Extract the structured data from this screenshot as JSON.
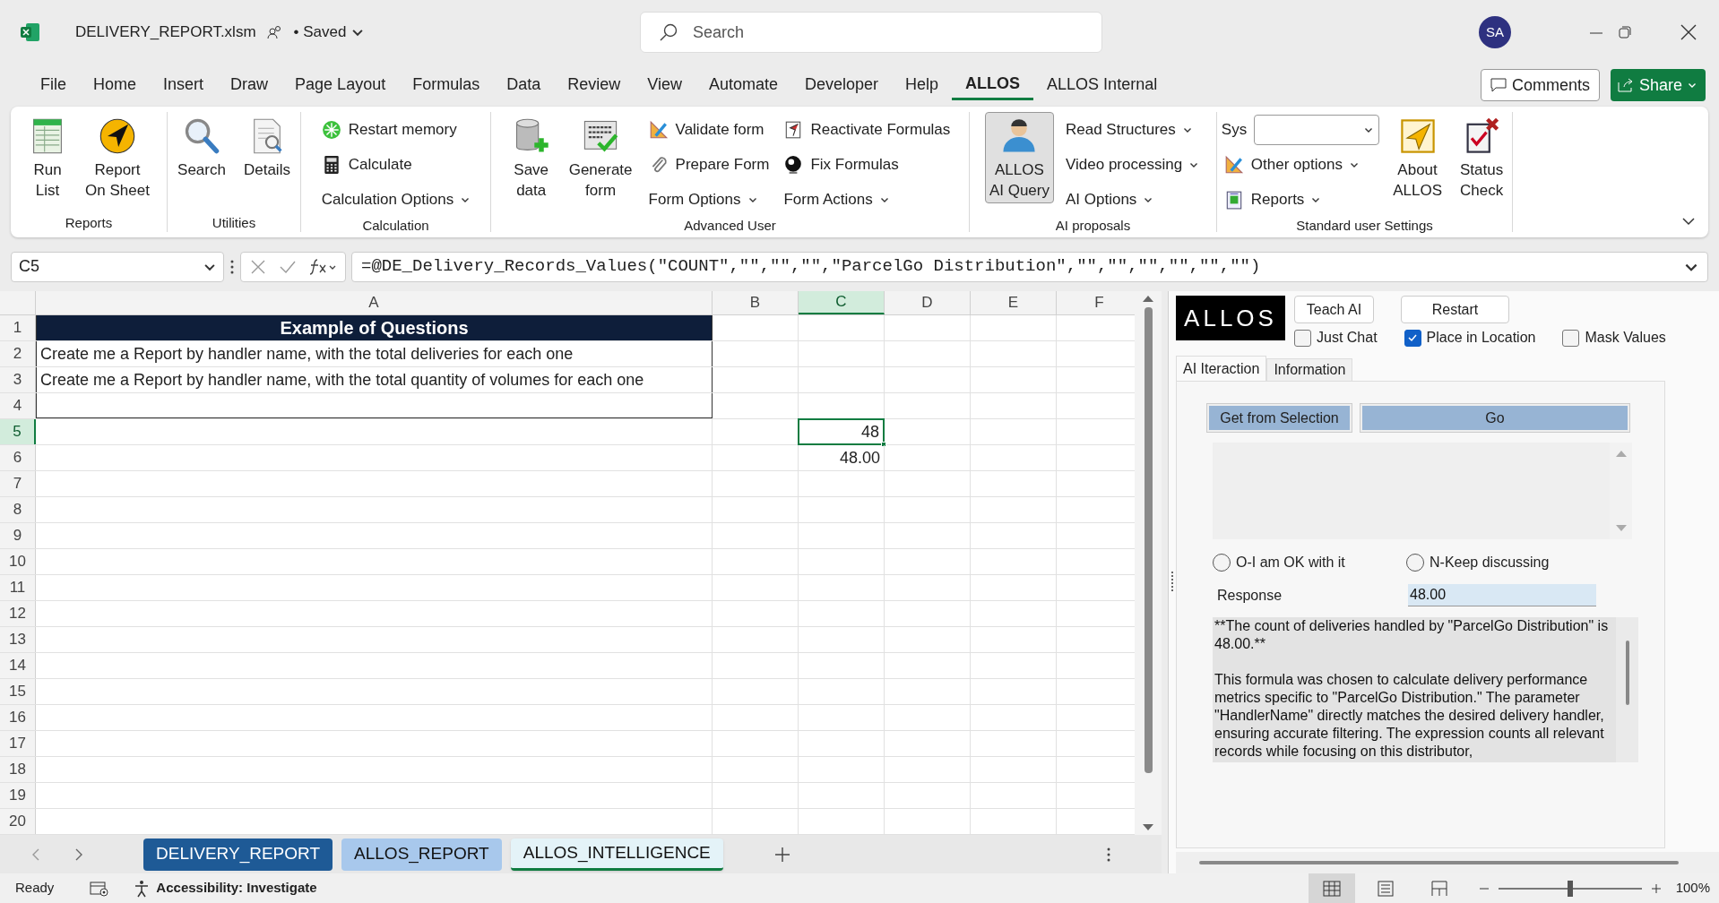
{
  "title_bar": {
    "file_name": "DELIVERY_REPORT.xlsm",
    "save_status": "• Saved",
    "search": {
      "placeholder": "Search"
    },
    "avatar": "SA"
  },
  "menu_tabs": [
    {
      "label": "File",
      "selected": false
    },
    {
      "label": "Home",
      "selected": false
    },
    {
      "label": "Insert",
      "selected": false
    },
    {
      "label": "Draw",
      "selected": false
    },
    {
      "label": "Page Layout",
      "selected": false
    },
    {
      "label": "Formulas",
      "selected": false
    },
    {
      "label": "Data",
      "selected": false
    },
    {
      "label": "Review",
      "selected": false
    },
    {
      "label": "View",
      "selected": false
    },
    {
      "label": "Automate",
      "selected": false
    },
    {
      "label": "Developer",
      "selected": false
    },
    {
      "label": "Help",
      "selected": false
    },
    {
      "label": "ALLOS",
      "selected": true
    },
    {
      "label": "ALLOS Internal",
      "selected": false
    }
  ],
  "comments_button": "Comments",
  "share_button": "Share",
  "ribbon": {
    "groups": [
      {
        "label": "Reports",
        "items": [
          {
            "kind": "large",
            "lines": [
              "Run",
              "List"
            ],
            "pressed": false
          },
          {
            "kind": "large",
            "lines": [
              "Report",
              "On Sheet"
            ],
            "pressed": false
          }
        ]
      },
      {
        "label": "Utilities",
        "items": [
          {
            "kind": "large",
            "lines": [
              "Search"
            ],
            "pressed": false
          },
          {
            "kind": "large",
            "lines": [
              "Details"
            ],
            "pressed": false
          }
        ]
      },
      {
        "label": "Calculation",
        "items": [
          {
            "kind": "small",
            "label": "Restart memory",
            "pressed": false
          },
          {
            "kind": "small",
            "label": "Calculate",
            "pressed": false
          },
          {
            "kind": "menu",
            "label": "Calculation Options",
            "pressed": false
          }
        ]
      },
      {
        "label": "Advanced User",
        "items": [
          {
            "kind": "large",
            "lines": [
              "Save",
              "data"
            ],
            "pressed": false
          },
          {
            "kind": "large",
            "lines": [
              "Generate",
              "form"
            ],
            "pressed": false
          },
          {
            "kind": "small",
            "label": "Validate form",
            "pressed": false
          },
          {
            "kind": "small",
            "label": "Prepare Form",
            "pressed": false
          },
          {
            "kind": "menu",
            "label": "Form Options",
            "pressed": false
          },
          {
            "kind": "small",
            "label": "Reactivate Formulas",
            "pressed": false
          },
          {
            "kind": "small",
            "label": "Fix Formulas",
            "pressed": false
          },
          {
            "kind": "menu",
            "label": "Form Actions",
            "pressed": false
          }
        ]
      },
      {
        "label": "AI proposals",
        "items": [
          {
            "kind": "large",
            "lines": [
              "ALLOS",
              "AI Query"
            ],
            "pressed": true
          },
          {
            "kind": "menu",
            "label": "Read Structures",
            "pressed": false
          },
          {
            "kind": "menu",
            "label": "Video processing",
            "pressed": false
          },
          {
            "kind": "menu",
            "label": "AI Options",
            "pressed": false
          }
        ]
      },
      {
        "label": "Standard user Settings",
        "items": [
          {
            "kind": "field",
            "label": "Sys",
            "pressed": false
          },
          {
            "kind": "small_menu",
            "label": "Other options",
            "pressed": false
          },
          {
            "kind": "small_menu",
            "label": "Reports",
            "pressed": false
          },
          {
            "kind": "large",
            "lines": [
              "About",
              "ALLOS"
            ],
            "pressed": false
          },
          {
            "kind": "large",
            "lines": [
              "Status",
              "Check"
            ],
            "pressed": false
          }
        ]
      }
    ]
  },
  "formula_bar": {
    "name_box": "C5",
    "formula": "=@DE_Delivery_Records_Values(\"COUNT\",\"\",\"\",\"\",\"ParcelGo Distribution\",\"\",\"\",\"\",\"\",\"\",\"\")"
  },
  "sheet": {
    "columns": [
      {
        "label": "A",
        "selected": false
      },
      {
        "label": "B",
        "selected": false
      },
      {
        "label": "C",
        "selected": true
      },
      {
        "label": "D",
        "selected": false
      },
      {
        "label": "E",
        "selected": false
      },
      {
        "label": "F",
        "selected": false
      }
    ],
    "rows": [
      {
        "label": "1",
        "selected": false,
        "cells": {
          "A": {
            "kind": "heading",
            "text": "Example of Questions",
            "selected": false
          }
        }
      },
      {
        "label": "2",
        "selected": false,
        "cells": {
          "A": {
            "kind": "text",
            "text": "Create me a Report by handler name, with the total deliveries for each one",
            "selected": false
          }
        }
      },
      {
        "label": "3",
        "selected": false,
        "cells": {
          "A": {
            "kind": "text",
            "text": "Create me a Report by handler name, with the total quantity of volumes for each one",
            "selected": false
          }
        }
      },
      {
        "label": "4",
        "selected": false
      },
      {
        "label": "5",
        "selected": true,
        "cells": {
          "C": {
            "kind": "number",
            "text": "48",
            "selected": true
          }
        }
      },
      {
        "label": "6",
        "selected": false,
        "cells": {
          "C": {
            "kind": "number",
            "text": "48.00",
            "selected": false
          }
        }
      },
      {
        "label": "7",
        "selected": false
      },
      {
        "label": "8",
        "selected": false
      },
      {
        "label": "9",
        "selected": false
      },
      {
        "label": "10",
        "selected": false
      },
      {
        "label": "11",
        "selected": false
      },
      {
        "label": "12",
        "selected": false
      },
      {
        "label": "13",
        "selected": false
      },
      {
        "label": "14",
        "selected": false
      },
      {
        "label": "15",
        "selected": false
      },
      {
        "label": "16",
        "selected": false
      },
      {
        "label": "17",
        "selected": false
      },
      {
        "label": "18",
        "selected": false
      },
      {
        "label": "19",
        "selected": false
      },
      {
        "label": "20",
        "selected": false
      }
    ]
  },
  "sheet_tabs": [
    {
      "label": "DELIVERY_REPORT",
      "selected": false,
      "color": "#1e5a96"
    },
    {
      "label": "ALLOS_REPORT",
      "selected": false,
      "color": "#a8c8ec"
    },
    {
      "label": "ALLOS_INTELLIGENCE",
      "selected": true,
      "color": "#e4f3f8"
    }
  ],
  "panel": {
    "logo": "ALLOS",
    "buttons": [
      "Teach AI",
      "Restart"
    ],
    "options": [
      {
        "label": "Just Chat",
        "checked": false
      },
      {
        "label": "Place in Location",
        "checked": true
      },
      {
        "label": "Mask Values",
        "checked": false
      }
    ],
    "tabs": [
      {
        "label": "AI Iteraction",
        "selected": true
      },
      {
        "label": "Information",
        "selected": false
      }
    ],
    "action_buttons": [
      "Get from Selection",
      "Go"
    ],
    "choices": [
      {
        "label": "O-I am OK with it",
        "selected": false
      },
      {
        "label": "N-Keep discussing",
        "selected": false
      }
    ],
    "response": {
      "label": "Response",
      "value": "48.00",
      "paragraphs": [
        "**The count of deliveries handled by \"ParcelGo Distribution\" is 48.00.**",
        "This formula was chosen to calculate delivery performance metrics specific to \"ParcelGo Distribution.\" The parameter \"HandlerName\" directly matches the desired delivery handler, ensuring accurate filtering. The expression counts all relevant records while focusing on this distributor,"
      ]
    }
  },
  "status_bar": {
    "status": "Ready",
    "accessibility": "Accessibility: Investigate",
    "views": [
      {
        "kind": "normal",
        "selected": true
      },
      {
        "kind": "page_layout",
        "selected": false
      },
      {
        "kind": "page_break",
        "selected": false
      }
    ],
    "zoom_slider": {
      "level": 0.5
    },
    "zoom": "100%"
  }
}
